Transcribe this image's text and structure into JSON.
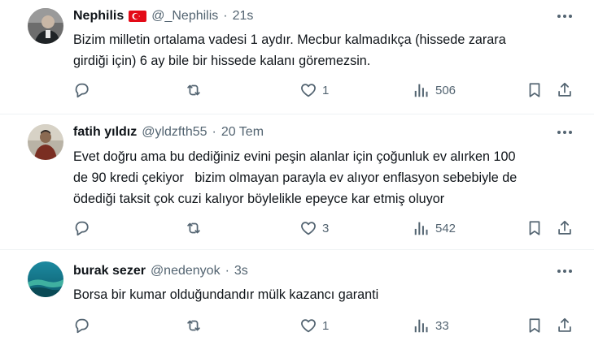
{
  "tweets": [
    {
      "name": "Nephilis",
      "has_flag": true,
      "handle": "@_Nephilis",
      "separator": "·",
      "time": "21s",
      "text_lines": [
        "Bizim milletin ortalama vadesi 1 aydır. Mecbur kalmadıkça (hissede zarara",
        "girdiği için) 6 ay bile bir hissede kalanı göremezsin."
      ],
      "likes": "1",
      "views": "506"
    },
    {
      "name": "fatih yıldız",
      "has_flag": false,
      "handle": "@yldzfth55",
      "separator": "·",
      "time": "20 Tem",
      "text_lines": [
        "Evet doğru ama bu dediğiniz evini peşin alanlar için çoğunluk ev alırken 100",
        "de 90 kredi çekiyor   bizim olmayan parayla ev alıyor enflasyon sebebiyle de",
        "ödediği taksit çok cuzi kalıyor böylelikle epeyce kar etmiş oluyor"
      ],
      "likes": "3",
      "views": "542"
    },
    {
      "name": "burak sezer",
      "has_flag": false,
      "handle": "@nedenyok",
      "separator": "·",
      "time": "3s",
      "text_lines": [
        "Borsa bir kumar olduğundandır mülk kazancı garanti"
      ],
      "likes": "1",
      "views": "33"
    }
  ],
  "icons": {
    "reply": "reply-icon",
    "retweet": "retweet-icon",
    "like": "heart-icon",
    "views": "views-icon",
    "bookmark": "bookmark-icon",
    "share": "share-icon",
    "more": "more-icon",
    "flag": "turkey-flag-icon"
  },
  "colors": {
    "text": "#0f1419",
    "muted": "#536471",
    "divider": "#eff3f4",
    "flag_red": "#e30a17"
  }
}
